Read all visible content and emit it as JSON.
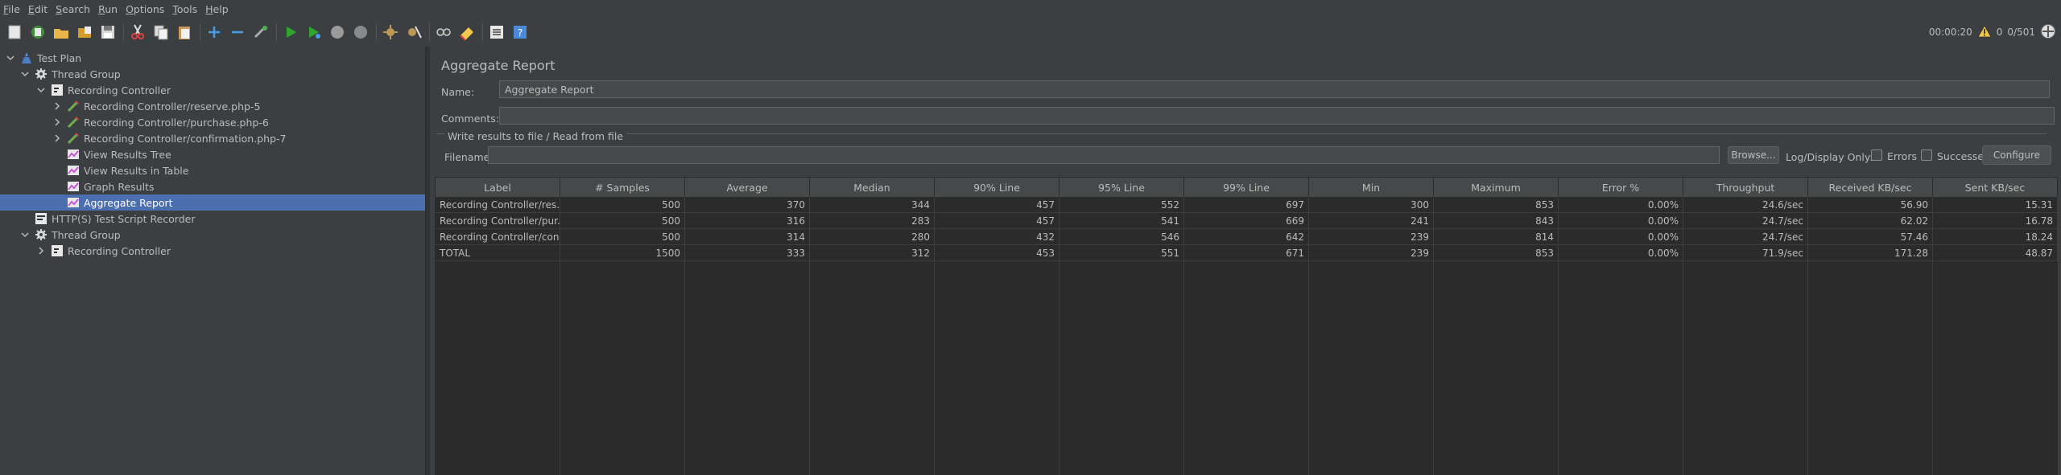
{
  "menu": [
    {
      "label": "File",
      "mn": "F",
      "rest": "ile"
    },
    {
      "label": "Edit",
      "mn": "E",
      "rest": "dit"
    },
    {
      "label": "Search",
      "mn": "S",
      "rest": "earch"
    },
    {
      "label": "Run",
      "mn": "R",
      "rest": "un"
    },
    {
      "label": "Options",
      "mn": "O",
      "rest": "ptions"
    },
    {
      "label": "Tools",
      "mn": "T",
      "rest": "ools"
    },
    {
      "label": "Help",
      "mn": "H",
      "rest": "elp"
    }
  ],
  "status": {
    "elapsed": "00:00:20",
    "warnings": "0",
    "threads": "0/501"
  },
  "tree": [
    {
      "label": "Test Plan",
      "depth": 0,
      "expanded": true,
      "icon": "test-plan-icon"
    },
    {
      "label": "Thread Group",
      "depth": 1,
      "expanded": true,
      "icon": "gear-icon"
    },
    {
      "label": "Recording Controller",
      "depth": 2,
      "expanded": true,
      "icon": "controller-icon"
    },
    {
      "label": "Recording Controller/reserve.php-5",
      "depth": 3,
      "expanded": false,
      "icon": "sampler-icon"
    },
    {
      "label": "Recording Controller/purchase.php-6",
      "depth": 3,
      "expanded": false,
      "icon": "sampler-icon"
    },
    {
      "label": "Recording Controller/confirmation.php-7",
      "depth": 3,
      "expanded": false,
      "icon": "sampler-icon"
    },
    {
      "label": "View Results Tree",
      "depth": 3,
      "leaf": true,
      "icon": "listener-icon"
    },
    {
      "label": "View Results in Table",
      "depth": 3,
      "leaf": true,
      "icon": "listener-icon"
    },
    {
      "label": "Graph Results",
      "depth": 3,
      "leaf": true,
      "icon": "listener-icon"
    },
    {
      "label": "Aggregate Report",
      "depth": 3,
      "leaf": true,
      "icon": "listener-icon",
      "selected": true
    },
    {
      "label": "HTTP(S) Test Script Recorder",
      "depth": 1,
      "leaf": true,
      "icon": "recorder-icon"
    },
    {
      "label": "Thread Group",
      "depth": 1,
      "expanded": true,
      "icon": "gear-icon"
    },
    {
      "label": "Recording Controller",
      "depth": 2,
      "expanded": false,
      "icon": "controller-icon"
    }
  ],
  "panel": {
    "title": "Aggregate Report",
    "name_label": "Name:",
    "name_value": "Aggregate Report",
    "comments_label": "Comments:",
    "comments_value": "",
    "write_label": "Write results to file / Read from file",
    "filename_label": "Filename",
    "filename_value": "",
    "browse_label": "Browse...",
    "log_display_label": "Log/Display Only:",
    "errors_label": "Errors",
    "successes_label": "Successes",
    "configure_label": "Configure"
  },
  "table": {
    "columns": [
      "Label",
      "# Samples",
      "Average",
      "Median",
      "90% Line",
      "95% Line",
      "99% Line",
      "Min",
      "Maximum",
      "Error %",
      "Throughput",
      "Received KB/sec",
      "Sent KB/sec"
    ],
    "rows": [
      [
        "Recording Controller/res...",
        "500",
        "370",
        "344",
        "457",
        "552",
        "697",
        "300",
        "853",
        "0.00%",
        "24.6/sec",
        "56.90",
        "15.31"
      ],
      [
        "Recording Controller/pur...",
        "500",
        "316",
        "283",
        "457",
        "541",
        "669",
        "241",
        "843",
        "0.00%",
        "24.7/sec",
        "62.02",
        "16.78"
      ],
      [
        "Recording Controller/con...",
        "500",
        "314",
        "280",
        "432",
        "546",
        "642",
        "239",
        "814",
        "0.00%",
        "24.7/sec",
        "57.46",
        "18.24"
      ],
      [
        "TOTAL",
        "1500",
        "333",
        "312",
        "453",
        "551",
        "671",
        "239",
        "853",
        "0.00%",
        "71.9/sec",
        "171.28",
        "48.87"
      ]
    ]
  }
}
